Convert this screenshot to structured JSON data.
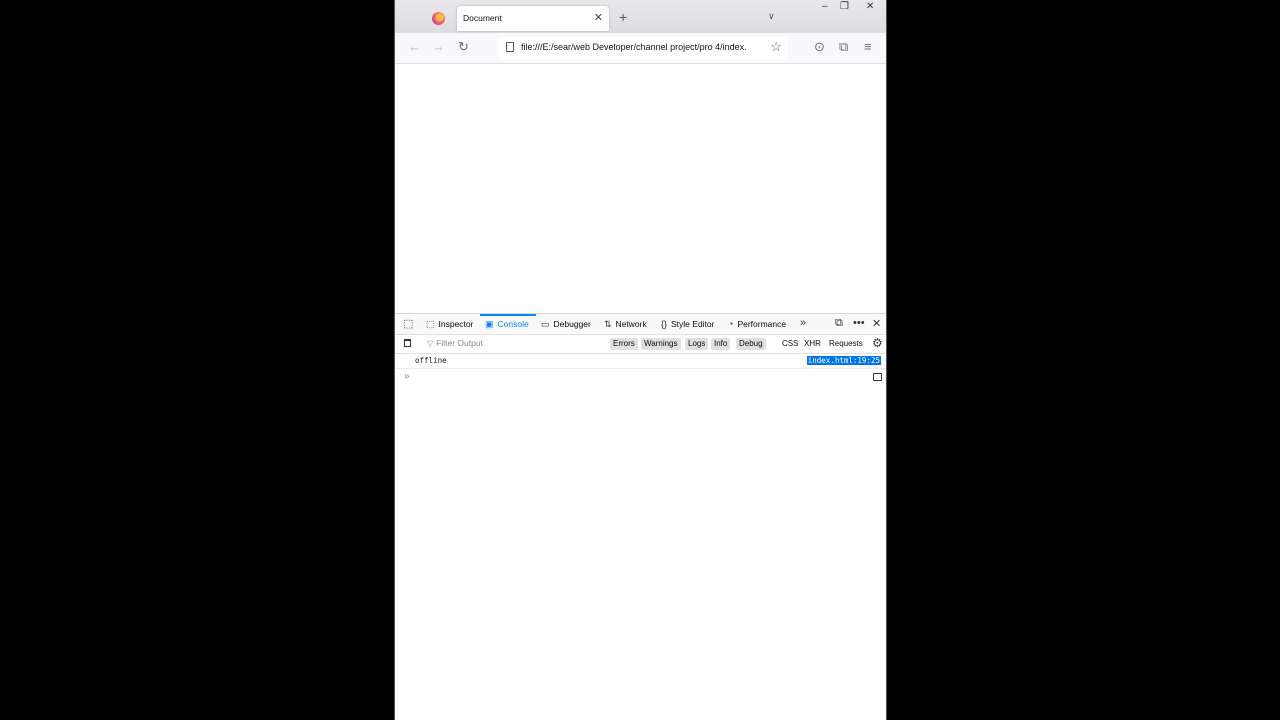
{
  "browser": {
    "tab_title": "Document",
    "tab_close_glyph": "✕",
    "new_tab_glyph": "+",
    "list_tabs_glyph": "∨",
    "window_controls": {
      "minimize": "–",
      "maximize": "❐",
      "close": "✕"
    },
    "url": "file:///E:/sear/web Developer/channel project/pro 4/index.",
    "nav": {
      "back": "←",
      "forward": "→",
      "reload": "↻",
      "star": "☆",
      "pocket": "⊙",
      "extensions": "⧉",
      "menu": "≡"
    }
  },
  "devtools": {
    "tabs": [
      {
        "label": "Inspector",
        "icon": "⬚"
      },
      {
        "label": "Console",
        "icon": "▣"
      },
      {
        "label": "Debugger",
        "icon": "▭"
      },
      {
        "label": "Network",
        "icon": "⇅"
      },
      {
        "label": "Style Editor",
        "icon": "{}"
      },
      {
        "label": "Performance",
        "icon": "◔"
      }
    ],
    "more_tabs_glyph": "»",
    "filter_placeholder": "Filter Output",
    "filters": {
      "levels": [
        "Errors",
        "Warnings",
        "Logs",
        "Info",
        "Debug"
      ],
      "types": [
        "CSS",
        "XHR",
        "Requests"
      ]
    },
    "messages": [
      {
        "text": "offline",
        "source": "index.html:19:25"
      }
    ],
    "prompt_glyph": "»",
    "accent_color": "#0a84ff"
  }
}
